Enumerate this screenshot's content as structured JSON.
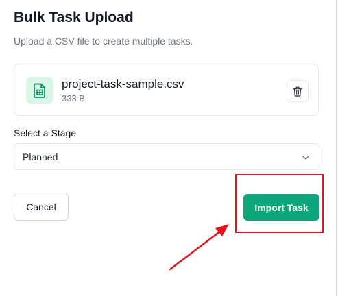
{
  "dialog": {
    "title": "Bulk Task Upload",
    "subtitle": "Upload a CSV file to create multiple tasks."
  },
  "file": {
    "name": "project-task-sample.csv",
    "size": "333 B",
    "icon": "csv-file-icon",
    "delete_icon": "trash-icon"
  },
  "stage": {
    "label": "Select a Stage",
    "selected": "Planned",
    "icon": "chevron-down-icon"
  },
  "actions": {
    "cancel_label": "Cancel",
    "import_label": "Import Task"
  },
  "colors": {
    "accent": "#0da67a",
    "icon_bg": "#d9f5e6",
    "annotation": "#e0141a"
  }
}
